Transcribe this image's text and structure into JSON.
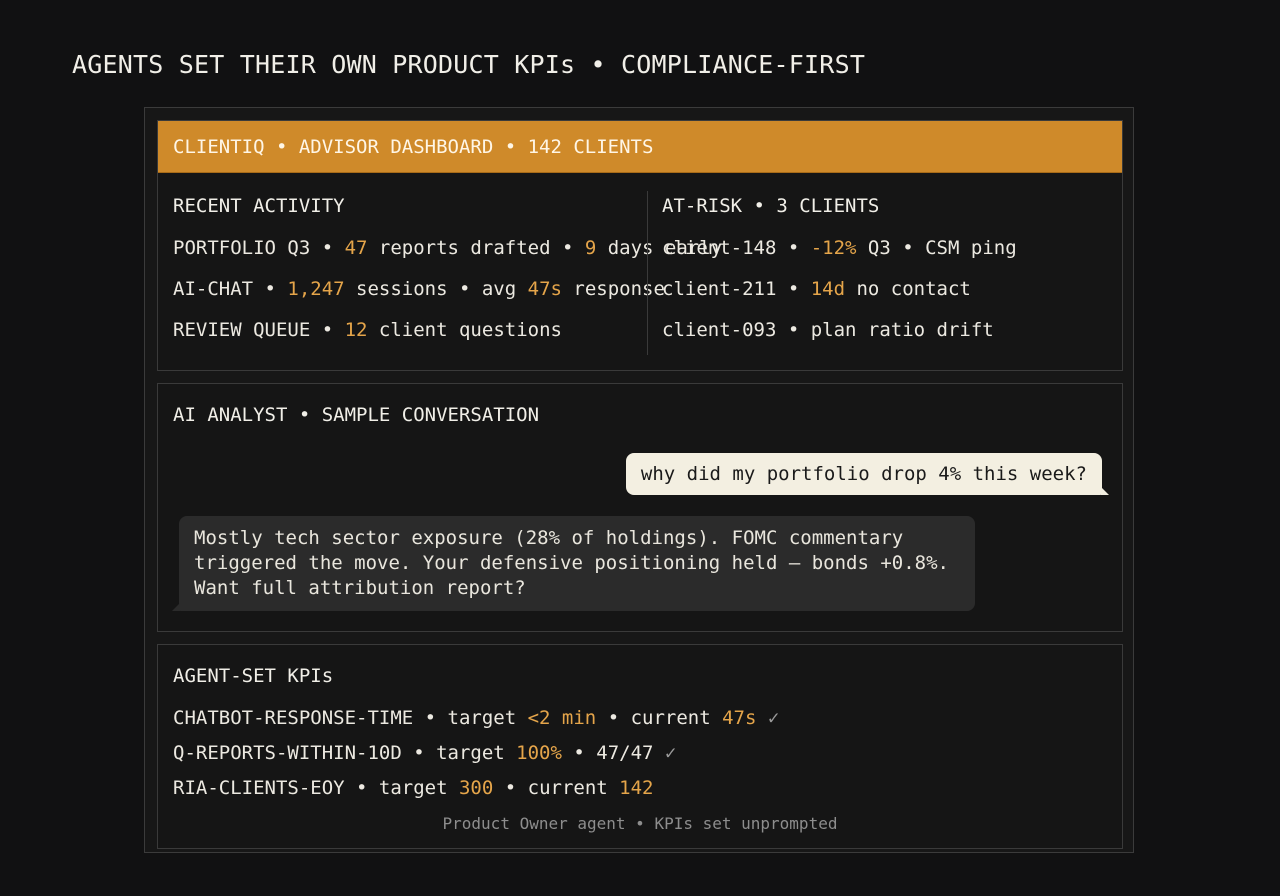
{
  "page_title": "AGENTS SET THEIR OWN PRODUCT KPIs • COMPLIANCE-FIRST",
  "dashboard": {
    "header": "CLIENTIQ • ADVISOR DASHBOARD • 142 CLIENTS",
    "recent_activity": {
      "title": "RECENT ACTIVITY",
      "rows": [
        {
          "a": "PORTFOLIO Q3 • ",
          "b": "47",
          "c": " reports drafted • ",
          "d": "9",
          "e": " days early"
        },
        {
          "a": "AI-CHAT • ",
          "b": "1,247",
          "c": " sessions • avg ",
          "d": "47s",
          "e": " response"
        },
        {
          "a": "REVIEW QUEUE • ",
          "b": "12",
          "c": " client questions"
        }
      ]
    },
    "at_risk": {
      "title": "AT-RISK • 3 CLIENTS",
      "rows": [
        {
          "a": "client-148 • ",
          "b": "-12%",
          "c": " Q3 • CSM ping"
        },
        {
          "a": "client-211 • ",
          "b": "14d",
          "c": " no contact"
        },
        {
          "a": "client-093 • plan ratio drift"
        }
      ]
    }
  },
  "conversation": {
    "title": "AI ANALYST • SAMPLE CONVERSATION",
    "user_message": "why did my portfolio drop 4% this week?",
    "ai_message": "Mostly tech sector exposure (28% of holdings). FOMC commentary triggered the move. Your defensive positioning held — bonds +0.8%. Want full attribution report?"
  },
  "kpis": {
    "title": "AGENT-SET KPIs",
    "rows": [
      {
        "a": "CHATBOT-RESPONSE-TIME • target ",
        "b": "<2 min",
        "c": " • current ",
        "d": "47s",
        "e": " ✓"
      },
      {
        "a": "Q-REPORTS-WITHIN-10D • target ",
        "b": "100%",
        "c": " • 47/47",
        "e": " ✓"
      },
      {
        "a": "RIA-CLIENTS-EOY • target ",
        "b": "300",
        "c": " • current ",
        "d": "142"
      }
    ],
    "footnote": "Product Owner agent • KPIs set unprompted"
  },
  "colors": {
    "accent": "#cf8a2a",
    "highlight": "#e5a54a",
    "background": "#111112"
  }
}
